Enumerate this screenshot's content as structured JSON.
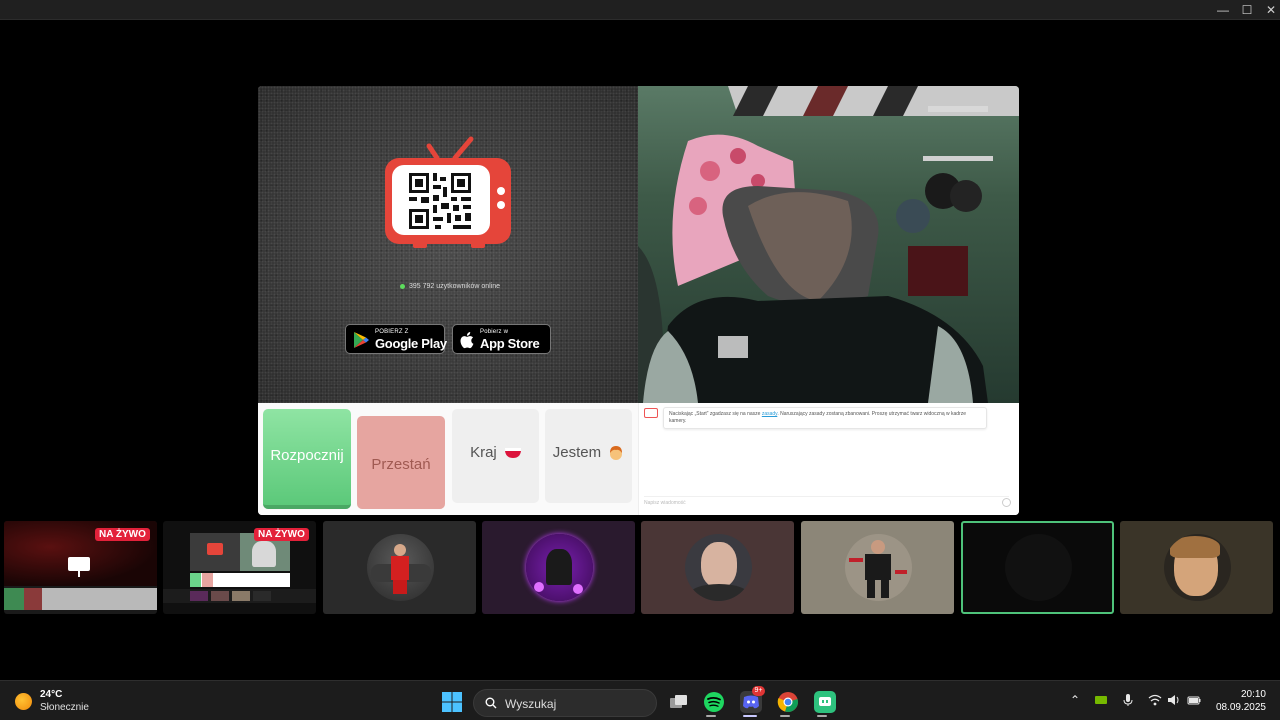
{
  "window": {
    "min_icon": "—",
    "max_icon": "☐",
    "close_icon": "✕"
  },
  "app": {
    "online_text": "395 792 użytkowników online",
    "google_play": {
      "small": "POBIERZ Z",
      "big": "Google Play"
    },
    "app_store": {
      "small": "Pobierz w",
      "big": "App Store"
    },
    "controls": {
      "start_label": "Rozpocznij",
      "stop_label": "Przestań",
      "country_label": "Kraj",
      "gender_label": "Jestem"
    },
    "chat": {
      "msg_before": "Naciskając „Start” zgadzasz się na nasze ",
      "msg_link": "zasady",
      "msg_after": ". Naruszający zasady zostaną zbanowani. Proszę utrzymać twarz widoczną w kadrze kamery.",
      "input_placeholder": "Napisz wiadomość"
    }
  },
  "tiles": [
    {
      "badge": "NA ŻYWO"
    },
    {
      "badge": "NA ŻYWO"
    }
  ],
  "taskbar": {
    "temperature": "24°C",
    "condition": "Słonecznie",
    "search_placeholder": "Wyszukaj",
    "discord_badge": "9+",
    "time": "20:10",
    "date": "08.09.2025"
  },
  "colors": {
    "accent_green": "#5cc97a",
    "stop_red": "#e6a5a0",
    "live_red": "#e3213a",
    "tv_red": "#e5453a"
  }
}
